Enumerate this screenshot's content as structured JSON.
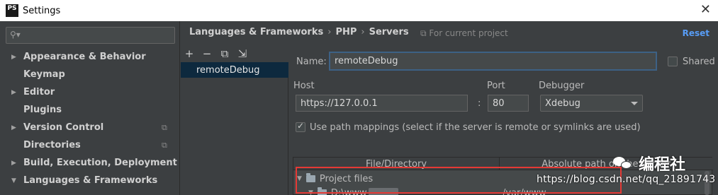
{
  "window": {
    "title": "Settings",
    "app_badge": "PS",
    "close_glyph": "✕"
  },
  "sidebar": {
    "search_icon": "🔍",
    "items": [
      {
        "label": "Appearance & Behavior",
        "expandable": true,
        "expanded": false
      },
      {
        "label": "Keymap",
        "expandable": false
      },
      {
        "label": "Editor",
        "expandable": true,
        "expanded": false
      },
      {
        "label": "Plugins",
        "expandable": false
      },
      {
        "label": "Version Control",
        "expandable": true,
        "expanded": false,
        "project_icon": true
      },
      {
        "label": "Directories",
        "expandable": false,
        "project_icon": true
      },
      {
        "label": "Build, Execution, Deployment",
        "expandable": true,
        "expanded": false
      },
      {
        "label": "Languages & Frameworks",
        "expandable": true,
        "expanded": true
      }
    ]
  },
  "breadcrumb": [
    "Languages & Frameworks",
    "PHP",
    "Servers"
  ],
  "for_project": "For current project",
  "reset_label": "Reset",
  "toolbar": {
    "add": "+",
    "remove": "−",
    "copy": "⧉",
    "import": "⇲"
  },
  "servers": [
    {
      "name": "remoteDebug",
      "selected": true
    }
  ],
  "form": {
    "name_label": "Name:",
    "name_value": "remoteDebug",
    "shared_label": "Shared",
    "host_label": "Host",
    "host_value": "https://127.0.0.1",
    "port_label": "Port",
    "port_sep": ":",
    "port_value": "80",
    "debugger_label": "Debugger",
    "debugger_value": "Xdebug",
    "path_mappings_label": "Use path mappings (select if the server is remote or symlinks are used)",
    "path_mappings_checked": true,
    "mappings": {
      "columns": [
        "File/Directory",
        "Absolute path on the server"
      ],
      "rows": [
        {
          "label": "Project files",
          "server_path": ""
        },
        {
          "label": "D:\\www",
          "server_path": "/var/www"
        }
      ]
    }
  },
  "watermark": {
    "brand": "编程社",
    "url": "https://blog.csdn.net/qq_21891743"
  },
  "colors": {
    "accent": "#589df6",
    "selection": "#0d293e",
    "highlight_box": "#e53935"
  }
}
